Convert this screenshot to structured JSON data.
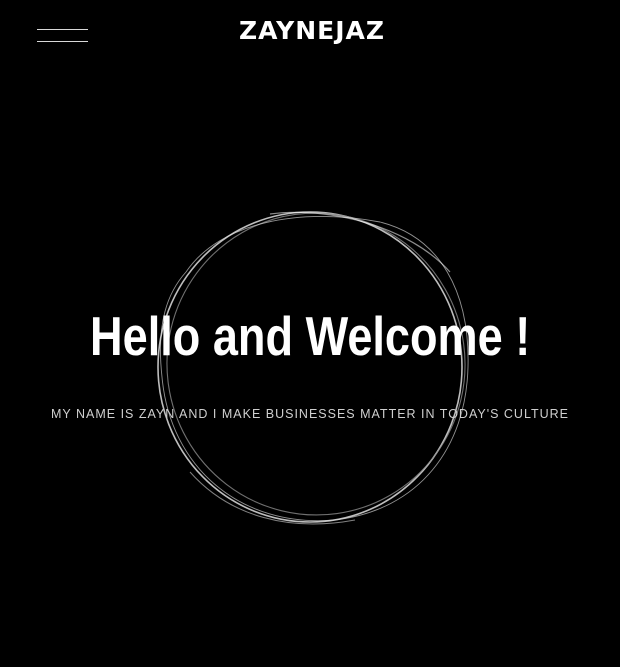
{
  "header": {
    "logo_text": "ZAYNEJAZ",
    "menu_icon": "hamburger-menu-icon"
  },
  "hero": {
    "title": "Hello and Welcome !",
    "subtitle": "MY NAME IS ZAYN AND I MAKE BUSINESSES MATTER IN TODAY'S CULTURE",
    "decoration_icon": "sketched-circle-icon"
  },
  "colors": {
    "background": "#000000",
    "text": "#ffffff",
    "subtitle": "#cfcfcf",
    "circle_stroke": "#bdbdbd"
  }
}
